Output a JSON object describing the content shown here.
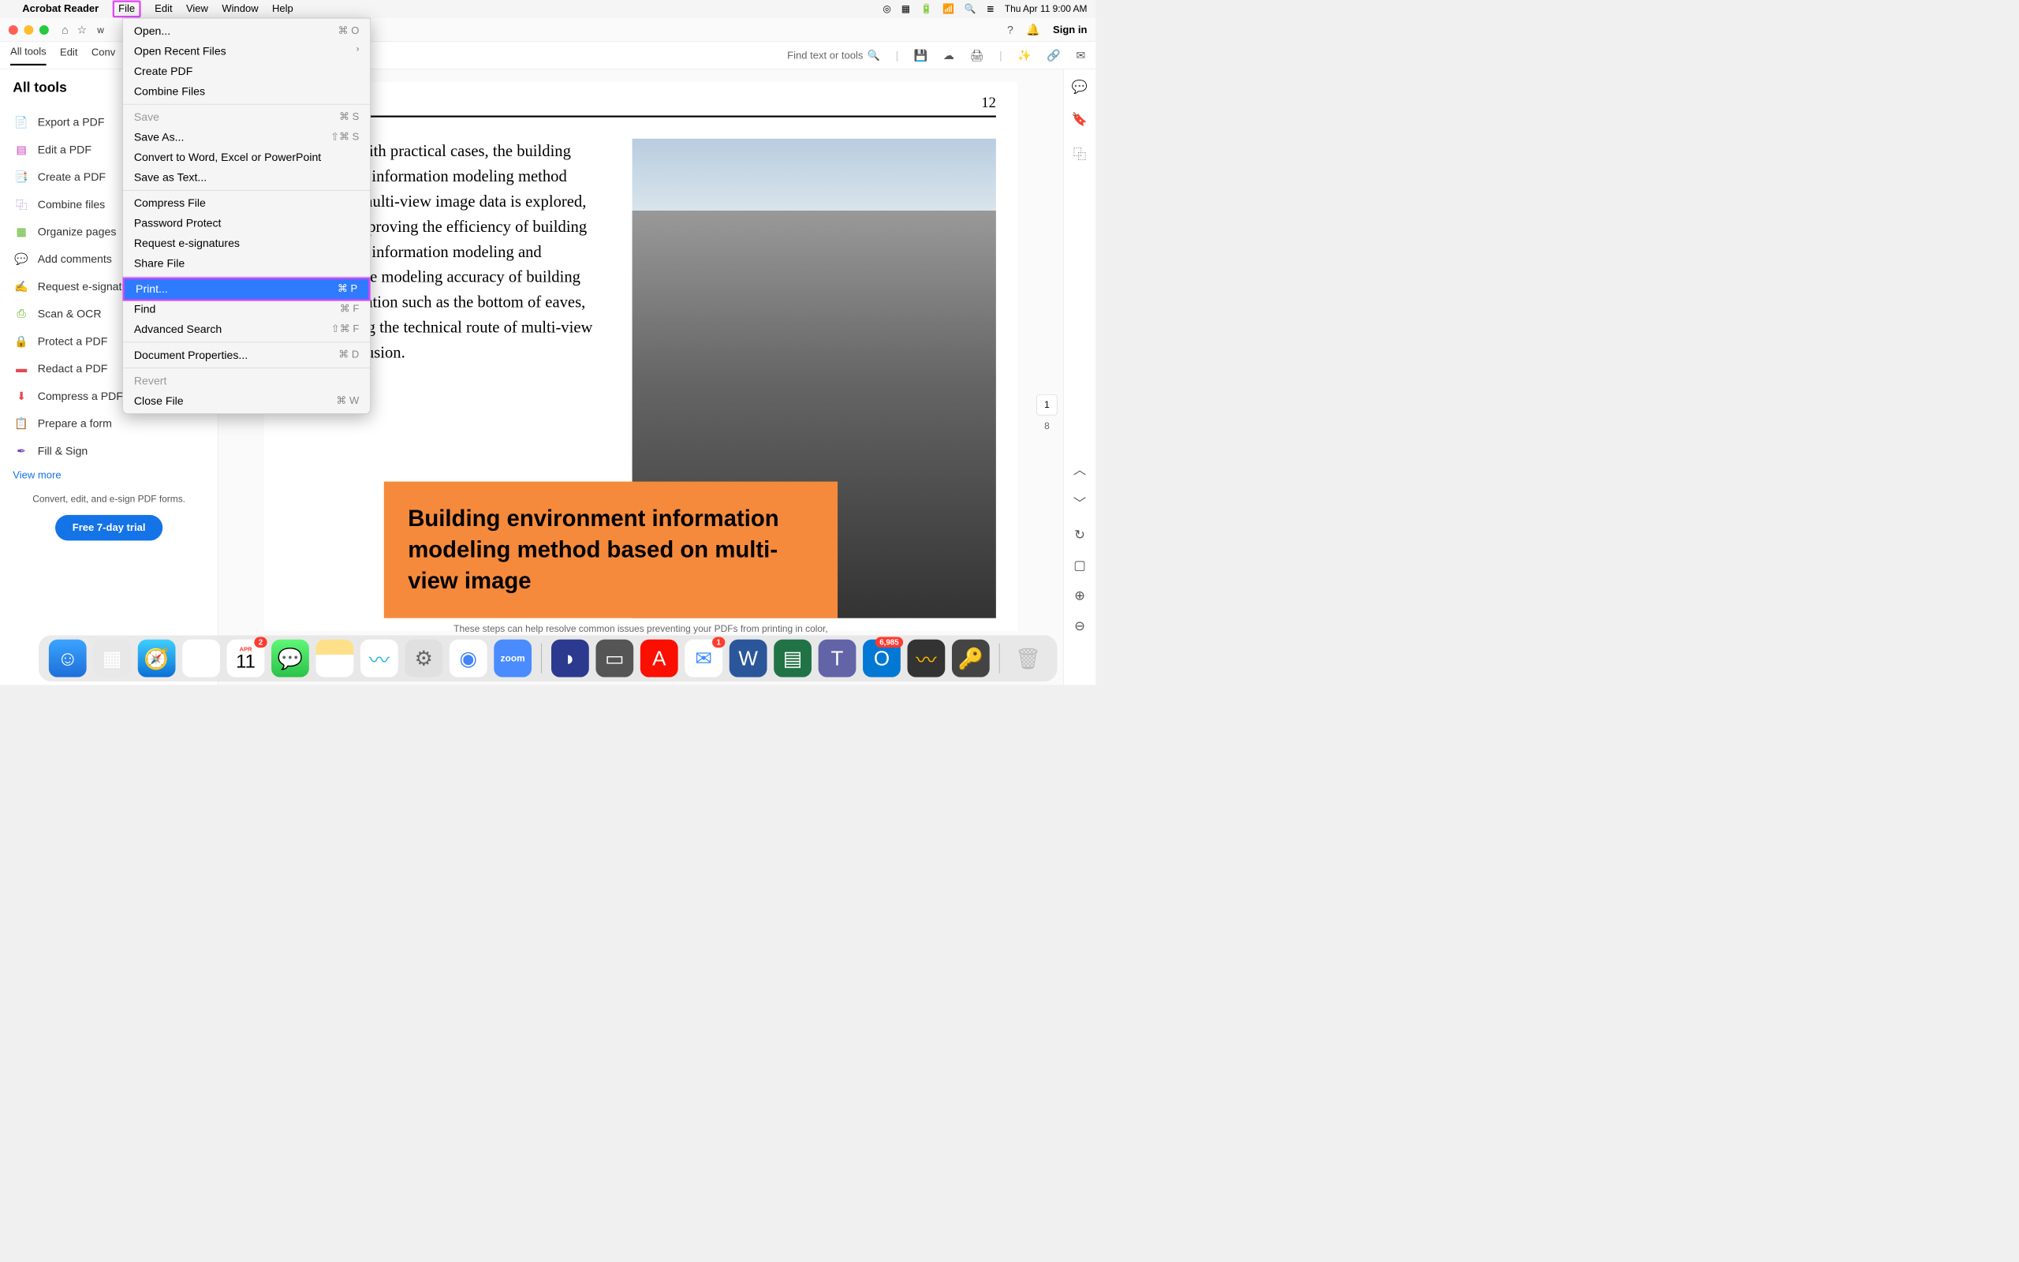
{
  "menubar": {
    "app": "Acrobat Reader",
    "items": [
      "File",
      "Edit",
      "View",
      "Window",
      "Help"
    ],
    "clock": "Thu Apr 11  9:00 AM"
  },
  "chrome": {
    "tab_partial": "w",
    "signin": "Sign in"
  },
  "toolbar": {
    "tabs": [
      "All tools",
      "Edit",
      "Conv"
    ],
    "find": "Find text or tools"
  },
  "sidebar": {
    "title": "All tools",
    "items": [
      {
        "icon": "📄",
        "color": "#e34850",
        "label": "Export a PDF"
      },
      {
        "icon": "▤",
        "color": "#c935b5",
        "label": "Edit a PDF"
      },
      {
        "icon": "📑",
        "color": "#e34850",
        "label": "Create a PDF"
      },
      {
        "icon": "⿻",
        "color": "#7a42bf",
        "label": "Combine files"
      },
      {
        "icon": "▦",
        "color": "#59b21f",
        "label": "Organize pages"
      },
      {
        "icon": "💬",
        "color": "#1473e6",
        "label": "Add comments"
      },
      {
        "icon": "✍",
        "color": "#7a42bf",
        "label": "Request e-signatu"
      },
      {
        "icon": "⎙",
        "color": "#59b21f",
        "label": "Scan & OCR"
      },
      {
        "icon": "🔒",
        "color": "#1473e6",
        "label": "Protect a PDF"
      },
      {
        "icon": "▬",
        "color": "#e34850",
        "label": "Redact a PDF"
      },
      {
        "icon": "⬇",
        "color": "#e34850",
        "label": "Compress a PDF"
      },
      {
        "icon": "📋",
        "color": "#7a42bf",
        "label": "Prepare a form"
      },
      {
        "icon": "✒",
        "color": "#7a42bf",
        "label": "Fill & Sign"
      }
    ],
    "view_more": "View more",
    "sub": "Convert, edit, and e-sign PDF forms.",
    "trial": "Free 7-day trial"
  },
  "dropdown": {
    "groups": [
      [
        {
          "label": "Open...",
          "short": "⌘ O"
        },
        {
          "label": "Open Recent Files",
          "chevron": true
        },
        {
          "label": "Create PDF"
        },
        {
          "label": "Combine Files"
        }
      ],
      [
        {
          "label": "Save",
          "short": "⌘ S",
          "disabled": true
        },
        {
          "label": "Save As...",
          "short": "⇧⌘ S"
        },
        {
          "label": "Convert to Word, Excel or PowerPoint"
        },
        {
          "label": "Save as Text..."
        }
      ],
      [
        {
          "label": "Compress File"
        },
        {
          "label": "Password Protect"
        },
        {
          "label": "Request e-signatures"
        },
        {
          "label": "Share File"
        }
      ],
      [
        {
          "label": "Print...",
          "short": "⌘ P",
          "highlight": true
        },
        {
          "label": "Find",
          "short": "⌘ F"
        },
        {
          "label": "Advanced Search",
          "short": "⇧⌘ F"
        }
      ],
      [
        {
          "label": "Document Properties...",
          "short": "⌘ D"
        }
      ],
      [
        {
          "label": "Revert",
          "disabled": true
        },
        {
          "label": "Close File",
          "short": "⌘ W"
        }
      ]
    ]
  },
  "page": {
    "number": "12",
    "body": "Combined with practical cases, the building environment information modeling method integrating multi-view image data is explored, aiming at improving the efficiency of building environment information modeling and improving the modeling accuracy of building local information such as the bottom of eaves, and exploring the technical route of multi-view image data fusion.",
    "callout": "Building environment information modeling method based on multi-view image"
  },
  "pager": {
    "current": "1",
    "total": "8"
  },
  "truncated": "These steps can help resolve common issues preventing your PDFs from printing in color,",
  "dock": {
    "cal_month": "APR",
    "cal_day": "11",
    "badges": {
      "cal": "2",
      "mail": "1",
      "outlook": "6,985"
    },
    "icons": [
      {
        "name": "finder",
        "bg": "linear-gradient(#3ba3ff,#1e6fd9)",
        "glyph": "☺"
      },
      {
        "name": "launchpad",
        "bg": "#e8e8e8",
        "glyph": "▦"
      },
      {
        "name": "safari",
        "bg": "linear-gradient(#3fd0ff,#0a6fd6)",
        "glyph": "🧭"
      },
      {
        "name": "photos",
        "bg": "#fff",
        "glyph": "✿"
      },
      {
        "name": "calendar",
        "cal": true,
        "badge": "cal"
      },
      {
        "name": "messages",
        "bg": "linear-gradient(#5ff777,#2bc24a)",
        "glyph": "💬"
      },
      {
        "name": "notes",
        "bg": "linear-gradient(#ffe08a 40%,#fff 40%)",
        "glyph": ""
      },
      {
        "name": "freeform",
        "bg": "#fff",
        "glyph": "〰",
        "color": "#2bb4d8"
      },
      {
        "name": "settings",
        "bg": "#e0e0e0",
        "glyph": "⚙",
        "color": "#666"
      },
      {
        "name": "chrome",
        "bg": "#fff",
        "glyph": "◉",
        "color": "#4285f4"
      },
      {
        "name": "zoom",
        "bg": "#4a8cff",
        "glyph": "zoom",
        "text": true
      },
      {
        "sep": true
      },
      {
        "name": "app1",
        "bg": "#2b3a8f",
        "glyph": "◗"
      },
      {
        "name": "app2",
        "bg": "#555",
        "glyph": "▭"
      },
      {
        "name": "acrobat",
        "bg": "#fa0f00",
        "glyph": "A"
      },
      {
        "name": "mail",
        "bg": "#fff",
        "glyph": "✉",
        "color": "#3a8fff",
        "badge": "mail"
      },
      {
        "name": "word",
        "bg": "#2b579a",
        "glyph": "W"
      },
      {
        "name": "excel",
        "bg": "#217346",
        "glyph": "▤"
      },
      {
        "name": "teams",
        "bg": "#6264a7",
        "glyph": "T"
      },
      {
        "name": "outlook",
        "bg": "#0078d4",
        "glyph": "O",
        "badge": "outlook"
      },
      {
        "name": "wave",
        "bg": "#333",
        "glyph": "〰",
        "color": "#ffb400"
      },
      {
        "name": "keychain",
        "bg": "#444",
        "glyph": "🔑"
      },
      {
        "sep": true
      },
      {
        "name": "trash",
        "bg": "transparent",
        "glyph": "🗑",
        "color": "#bbb"
      }
    ]
  }
}
